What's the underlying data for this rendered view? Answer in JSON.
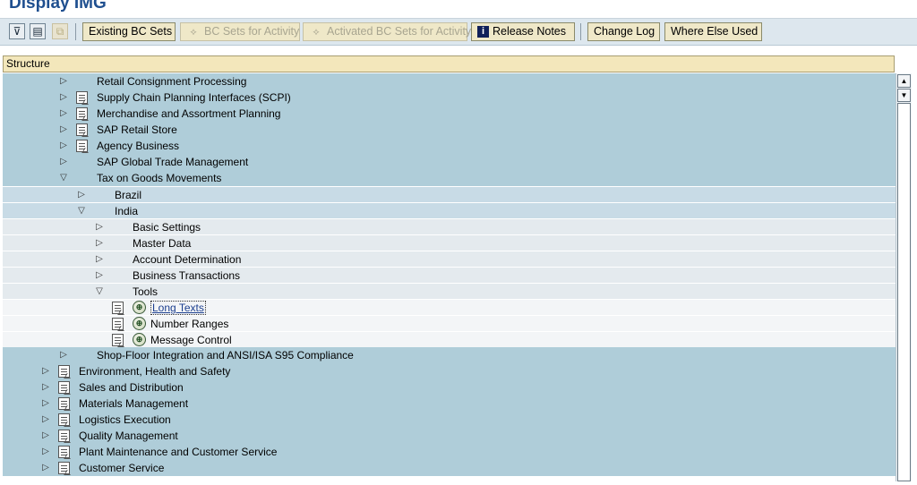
{
  "title": "Display IMG",
  "toolbar": {
    "icon_buttons": [
      {
        "name": "expand-all-icon",
        "glyph": "⊽",
        "disabled": false
      },
      {
        "name": "display-document-icon",
        "glyph": "▤",
        "disabled": false
      },
      {
        "name": "collapse-icon",
        "glyph": "⧉",
        "disabled": true
      }
    ],
    "buttons": [
      {
        "name": "existing-bc-sets-button",
        "label": "Existing BC Sets",
        "icon": "",
        "disabled": false
      },
      {
        "name": "bc-sets-for-activity-button",
        "label": "BC Sets for Activity",
        "icon": "bc-set-icon",
        "disabled": true
      },
      {
        "name": "activated-bc-sets-button",
        "label": "Activated BC Sets for Activity",
        "icon": "bc-set-icon",
        "disabled": true
      },
      {
        "name": "release-notes-button",
        "label": "Release Notes",
        "icon": "info-icon",
        "disabled": false
      },
      {
        "name": "change-log-button",
        "label": "Change Log",
        "icon": "",
        "disabled": false
      },
      {
        "name": "where-else-used-button",
        "label": "Where Else Used",
        "icon": "",
        "disabled": false
      }
    ]
  },
  "structure": {
    "header": "Structure",
    "rows": [
      {
        "label": "Retail Consignment Processing",
        "depth": 2,
        "state": "collapsed",
        "doc": false,
        "exec": false
      },
      {
        "label": "Supply Chain Planning Interfaces (SCPI)",
        "depth": 2,
        "state": "collapsed",
        "doc": true,
        "exec": false
      },
      {
        "label": "Merchandise and Assortment Planning",
        "depth": 2,
        "state": "collapsed",
        "doc": true,
        "exec": false
      },
      {
        "label": "SAP Retail Store",
        "depth": 2,
        "state": "collapsed",
        "doc": true,
        "exec": false
      },
      {
        "label": "Agency Business",
        "depth": 2,
        "state": "collapsed",
        "doc": true,
        "exec": false
      },
      {
        "label": "SAP Global Trade Management",
        "depth": 2,
        "state": "collapsed",
        "doc": false,
        "exec": false
      },
      {
        "label": "Tax on Goods Movements",
        "depth": 2,
        "state": "expanded",
        "doc": false,
        "exec": false
      },
      {
        "label": "Brazil",
        "depth": 3,
        "state": "collapsed",
        "doc": false,
        "exec": false
      },
      {
        "label": "India",
        "depth": 3,
        "state": "expanded",
        "doc": false,
        "exec": false
      },
      {
        "label": "Basic Settings",
        "depth": 4,
        "state": "collapsed",
        "doc": false,
        "exec": false
      },
      {
        "label": "Master Data",
        "depth": 4,
        "state": "collapsed",
        "doc": false,
        "exec": false
      },
      {
        "label": "Account Determination",
        "depth": 4,
        "state": "collapsed",
        "doc": false,
        "exec": false
      },
      {
        "label": "Business Transactions",
        "depth": 4,
        "state": "collapsed",
        "doc": false,
        "exec": false
      },
      {
        "label": "Tools",
        "depth": 4,
        "state": "expanded",
        "doc": false,
        "exec": false
      },
      {
        "label": "Long Texts",
        "depth": 5,
        "state": "leaf",
        "doc": true,
        "exec": true,
        "selected": true
      },
      {
        "label": "Number Ranges",
        "depth": 5,
        "state": "leaf",
        "doc": true,
        "exec": true
      },
      {
        "label": "Message Control",
        "depth": 5,
        "state": "leaf",
        "doc": true,
        "exec": true
      },
      {
        "label": "Shop-Floor Integration and ANSI/ISA S95 Compliance",
        "depth": 2,
        "state": "collapsed",
        "doc": false,
        "exec": false
      },
      {
        "label": "Environment, Health and Safety",
        "depth": 1,
        "state": "collapsed",
        "doc": true,
        "exec": false
      },
      {
        "label": "Sales and Distribution",
        "depth": 1,
        "state": "collapsed",
        "doc": true,
        "exec": false
      },
      {
        "label": "Materials Management",
        "depth": 1,
        "state": "collapsed",
        "doc": true,
        "exec": false
      },
      {
        "label": "Logistics Execution",
        "depth": 1,
        "state": "collapsed",
        "doc": true,
        "exec": false
      },
      {
        "label": "Quality Management",
        "depth": 1,
        "state": "collapsed",
        "doc": true,
        "exec": false
      },
      {
        "label": "Plant Maintenance and Customer Service",
        "depth": 1,
        "state": "collapsed",
        "doc": true,
        "exec": false
      },
      {
        "label": "Customer Service",
        "depth": 1,
        "state": "collapsed",
        "doc": true,
        "exec": false
      }
    ]
  },
  "scrollbar": {
    "up": "▲",
    "down": "▼"
  },
  "colors": {
    "title": "#1f4f8f",
    "tree_bg": "#afcdd9",
    "header_bg": "#f3e7bb"
  }
}
